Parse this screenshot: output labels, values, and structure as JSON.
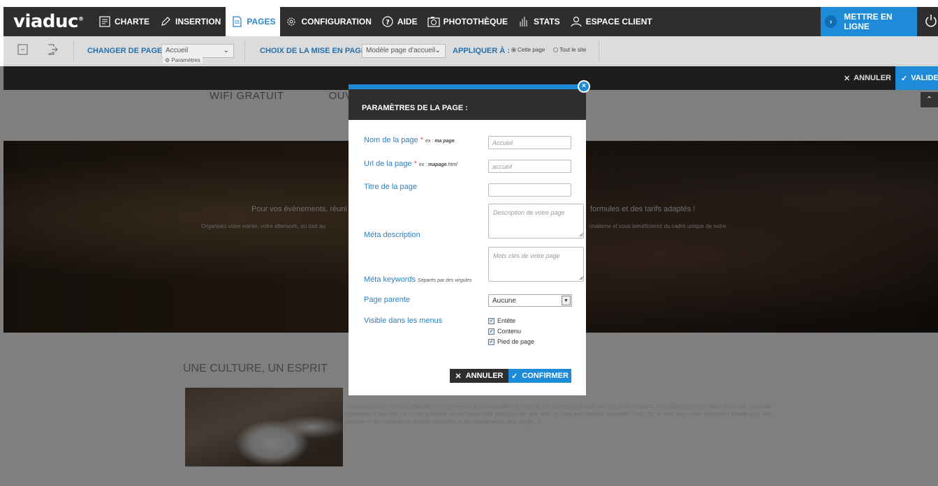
{
  "app": {
    "logo": "viaduc",
    "logo_mark": "®"
  },
  "nav": {
    "items": [
      {
        "label": "CHARTE",
        "icon": "charte-icon"
      },
      {
        "label": "INSERTION",
        "icon": "pencil-icon"
      },
      {
        "label": "PAGES",
        "icon": "pages-icon",
        "active": true
      },
      {
        "label": "CONFIGURATION",
        "icon": "gear-icon"
      },
      {
        "label": "AIDE",
        "icon": "help-icon"
      },
      {
        "label": "PHOTOTHÈQUE",
        "icon": "camera-icon"
      },
      {
        "label": "STATS",
        "icon": "stats-icon"
      },
      {
        "label": "ESPACE CLIENT",
        "icon": "user-icon"
      }
    ],
    "publish_label": "METTRE EN LIGNE"
  },
  "toolbar": {
    "change_page_label": "CHANGER DE PAGE",
    "page_select_value": "Accueil",
    "params_label": "Paramètres",
    "layout_label": "CHOIX DE LA MISE EN PAGE",
    "layout_select_value": "Modèle page d'accueil",
    "apply_label": "APPLIQUER À :",
    "apply_options": [
      "Cette page",
      "Tout le site"
    ],
    "apply_selected": "Cette page"
  },
  "editbar": {
    "cancel_label": "ANNULER",
    "validate_label": "VALIDER"
  },
  "background": {
    "banner_items": [
      "WIFI GRATUIT",
      "OUVERT"
    ],
    "hero_heading_left": "Pour vos évènements, réuni",
    "hero_heading_right": "formules et des tarifs adaptés !",
    "hero_text_left": "Organisez votre soirée, votre afterwork, ou tout au",
    "hero_text_right": "nnalisme et vous bénéficierez du cadre unique de notre",
    "section_title": "UNE CULTURE, UN ESPRIT",
    "paragraph": "Nous apportons un soin tout particulier à l'environnement et à la décoration de notre bar, car nous estimons qu'ils sont une partie intégrante de l'expérience de nos clients chez nous. Impossible d'apprécier un bon café, un en-cas gourmand ou une bonne bière pression entre amis dans un cadre peu lumineux, encombré, froid... En ce sens, nous avons longuement travaillé pour vous proposer un lieu convivial, une terrasse ensoleillée, et des espaces variés (pub, lounge...)"
  },
  "modal": {
    "title": "PARAMÈTRES DE LA PAGE :",
    "close_symbol": "×",
    "fields": {
      "name": {
        "label": "Nom de la page",
        "required": "*",
        "ex_prefix": "ex :",
        "ex_value": "ma page",
        "placeholder": "Accueil"
      },
      "url": {
        "label": "Url de la page",
        "required": "*",
        "ex_prefix": "ex :",
        "ex_value": "mapage",
        "ex_suffix": ".html",
        "placeholder": "accueil"
      },
      "title": {
        "label": "Titre de la page",
        "value": ""
      },
      "meta_desc": {
        "label": "Méta description",
        "placeholder": "Description de votre page"
      },
      "meta_keywords": {
        "label": "Méta keywords",
        "hint": "Séparés par des virgules",
        "placeholder": "Mots clés de votre page"
      },
      "parent": {
        "label": "Page parente",
        "value": "Aucune"
      },
      "visible": {
        "label": "Visible dans les menus",
        "options": [
          "Entête",
          "Contenu",
          "Pied de page"
        ]
      }
    },
    "cancel_label": "ANNULER",
    "confirm_label": "CONFIRMER"
  },
  "colors": {
    "accent": "#1d8bd8",
    "dark": "#2e2e2e",
    "label_blue": "#2f7fc0"
  }
}
